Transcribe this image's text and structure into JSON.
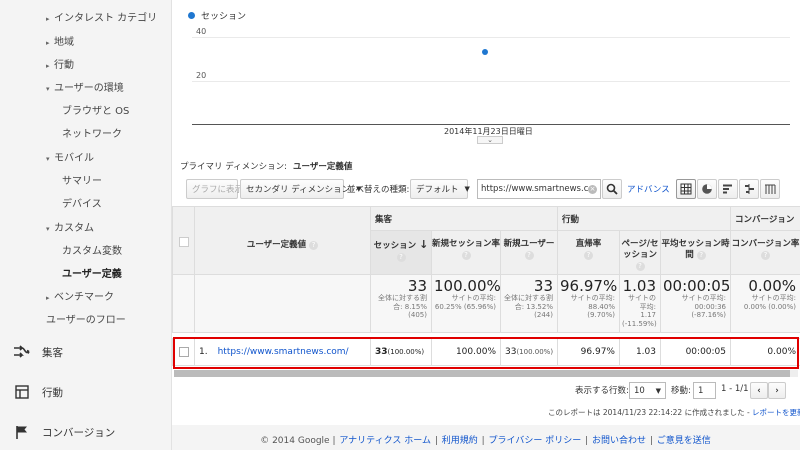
{
  "sidebar": {
    "items": [
      {
        "label": "インタレスト カテゴリ",
        "arrow": "▸"
      },
      {
        "label": "地域",
        "arrow": "▸"
      },
      {
        "label": "行動",
        "arrow": "▸"
      },
      {
        "label": "ユーザーの環境",
        "arrow": "▾"
      },
      {
        "label": "ブラウザと OS",
        "arrow": ""
      },
      {
        "label": "ネットワーク",
        "arrow": ""
      },
      {
        "label": "モバイル",
        "arrow": "▾"
      },
      {
        "label": "サマリー",
        "arrow": ""
      },
      {
        "label": "デバイス",
        "arrow": ""
      },
      {
        "label": "カスタム",
        "arrow": "▾"
      },
      {
        "label": "カスタム変数",
        "arrow": ""
      },
      {
        "label": "ユーザー定義",
        "arrow": ""
      },
      {
        "label": "ベンチマーク",
        "arrow": "▸"
      },
      {
        "label": "ユーザーのフロー",
        "arrow": ""
      }
    ],
    "sections": [
      {
        "label": "集客",
        "icon": "acquisition-icon"
      },
      {
        "label": "行動",
        "icon": "behavior-icon"
      },
      {
        "label": "コンバージョン",
        "icon": "flag-icon"
      }
    ]
  },
  "chart": {
    "legend": "セッション",
    "y_ticks": [
      "40",
      "20"
    ],
    "x_label": "2014年11月23日日曜日",
    "handle": "⌄"
  },
  "chart_data": {
    "type": "scatter",
    "x": [
      "2014年11月23日日曜日"
    ],
    "series": [
      {
        "name": "セッション",
        "values": [
          33
        ]
      }
    ],
    "ylim": [
      0,
      40
    ],
    "grid": true,
    "legend": "top-left",
    "color": "#1f77d0"
  },
  "primary_dimension": {
    "label": "プライマリ ディメンション:",
    "value": "ユーザー定義値"
  },
  "toolbar": {
    "plot_button": "グラフに表示",
    "secondary_dim": "セカンダリ ディメンション",
    "sort_label": "並べ替えの種類:",
    "sort_value": "デフォルト",
    "search_value": "https://www.smartnews.con",
    "advanced": "アドバンス"
  },
  "table": {
    "dim_header": "ユーザー定義値",
    "groups": [
      "集客",
      "行動",
      "コンバージョン"
    ],
    "metrics": [
      "セッション",
      "新規セッション率",
      "新規ユーザー",
      "直帰率",
      "ページ/セッション",
      "平均セッション時間",
      "コンバージョン率"
    ],
    "totals": [
      {
        "big": "33",
        "sub": "全体に対する割合: 8.15% (405)"
      },
      {
        "big": "100.00%",
        "sub": "サイトの平均: 60.25% (65.96%)"
      },
      {
        "big": "33",
        "sub": "全体に対する割合: 13.52% (244)"
      },
      {
        "big": "96.97%",
        "sub": "サイトの平均: 88.40% (9.70%)"
      },
      {
        "big": "1.03",
        "sub": "サイトの平均: 1.17 (-11.59%)"
      },
      {
        "big": "00:00:05",
        "sub": "サイトの平均: 00:00:36 (-87.16%)"
      },
      {
        "big": "0.00%",
        "sub": "サイトの平均: 0.00% (0.00%)"
      }
    ],
    "rows": [
      {
        "index": "1.",
        "dimension": "https://www.smartnews.com/",
        "sessions": "33",
        "sessions_pct": "(100.00%)",
        "new_session_rate": "100.00%",
        "new_users": "33",
        "new_users_pct": "(100.00%)",
        "bounce_rate": "96.97%",
        "pages_per_session": "1.03",
        "avg_duration": "00:00:05",
        "conversion_rate": "0.00%"
      }
    ]
  },
  "pagination": {
    "rows_label": "表示する行数:",
    "rows_value": "10",
    "goto_label": "移動:",
    "goto_value": "1",
    "range": "1 - 1/1",
    "prev": "‹",
    "next": "›"
  },
  "report_note": {
    "text": "このレポートは 2014/11/23 22:14:22 に作成されました - ",
    "link": "レポートを更新"
  },
  "footer": {
    "copyright": "© 2014 Google",
    "links": [
      "アナリティクス ホーム",
      "利用規約",
      "プライバシー ポリシー",
      "お問い合わせ",
      "ご意見を送信"
    ]
  },
  "colors": {
    "accent": "#1f77d0",
    "link": "#1155cc",
    "highlight": "#e00000"
  }
}
